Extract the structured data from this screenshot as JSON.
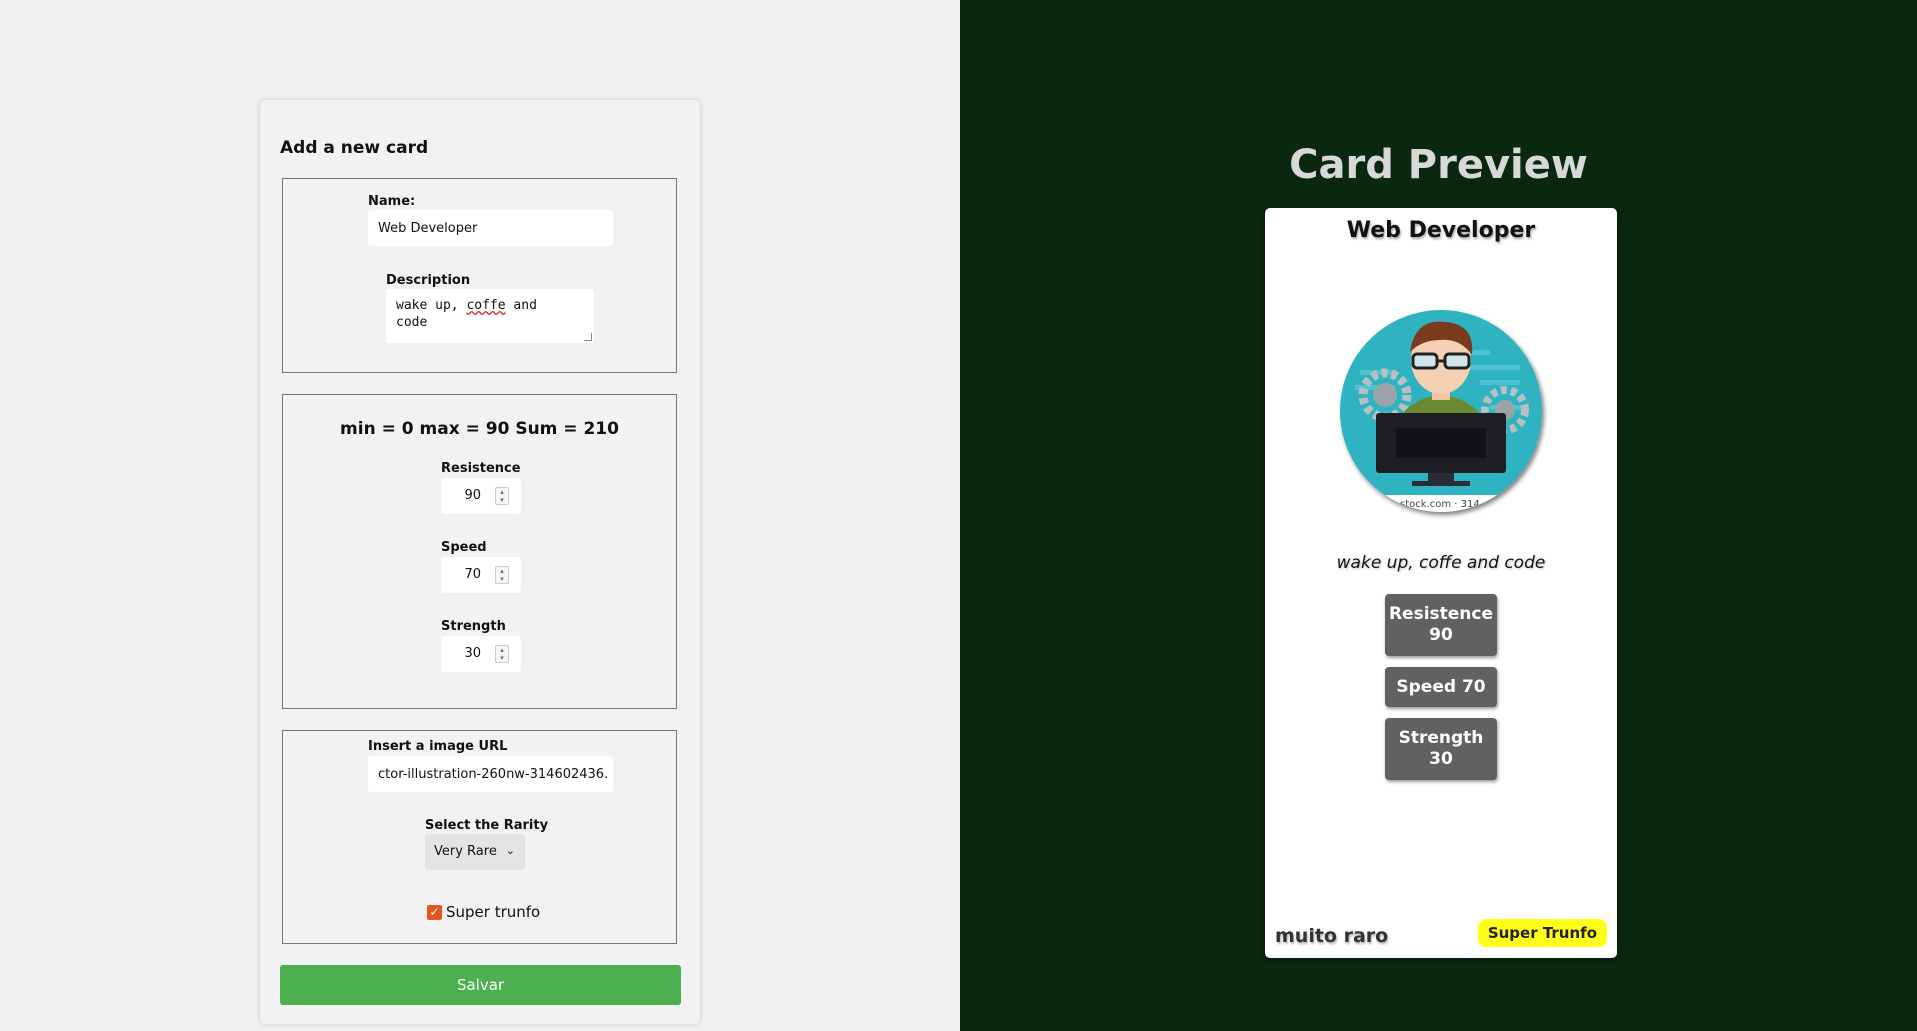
{
  "form": {
    "title": "Add a new card",
    "name_label": "Name:",
    "name_value": "Web Developer",
    "description_label": "Description",
    "description_line1_a": "wake up, ",
    "description_line1_spell": "coffe",
    "description_line1_b": " and",
    "description_line2": "code",
    "stats_header": "min = 0 max = 90 Sum = 210",
    "attrs": [
      {
        "label": "Resistence",
        "value": "90"
      },
      {
        "label": "Speed",
        "value": "70"
      },
      {
        "label": "Strength",
        "value": "30"
      }
    ],
    "image_label": "Insert a image URL",
    "image_value": "ctor-illustration-260nw-314602436.",
    "rarity_label": "Select the Rarity",
    "rarity_selected": "Very Rare",
    "trunfo_label": "Super trunfo",
    "trunfo_checked": true,
    "save_label": "Salvar"
  },
  "preview": {
    "title": "Card Preview",
    "card_name": "Web Developer",
    "image_watermark": "stock.com · 314",
    "description": "wake up, coffe and code",
    "attr1_line1": "Resistence",
    "attr1_line2": "90",
    "attr2": "Speed 70",
    "attr3_line1": "Strength",
    "attr3_line2": "30",
    "rarity": "muito raro",
    "trunfo_badge": "Super Trunfo"
  },
  "colors": {
    "right_bg": "#0a2810",
    "save_button": "#4caf50",
    "attr_bg": "#636060",
    "trunfo_badge": "#ffff1a",
    "checkbox": "#e2571f"
  }
}
